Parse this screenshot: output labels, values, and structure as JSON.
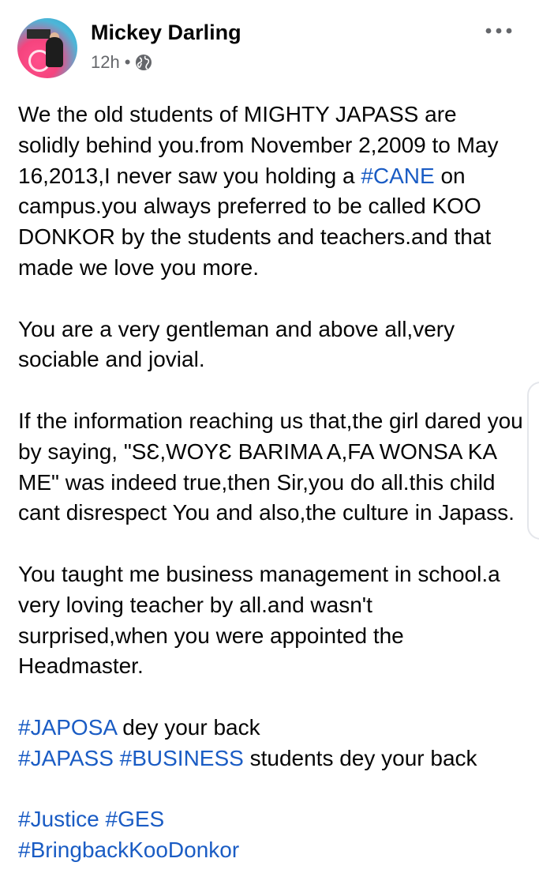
{
  "post": {
    "author": "Mickey Darling",
    "time": "12h",
    "separator": "•",
    "privacy_icon": "globe-icon",
    "more_icon": "more-options-icon",
    "paragraphs": [
      {
        "segments": [
          {
            "text": "We the old students of MIGHTY JAPASS are solidly behind you.from November 2,2009 to May 16,2013,I never saw you holding a "
          },
          {
            "text": "#CANE",
            "hashtag": true
          },
          {
            "text": " on campus.you always preferred to be called KOO DONKOR by the students and teachers.and that made we love you more."
          }
        ]
      },
      {
        "segments": [
          {
            "text": "You are a very gentleman and above all,very sociable and jovial."
          }
        ]
      },
      {
        "segments": [
          {
            "text": "If the information reaching us that,the girl dared you by saying, \"SƐ,WOYƐ BARIMA A,FA WONSA KA ME\" was indeed true,then Sir,you do all.this child cant disrespect You and also,the culture in Japass."
          }
        ]
      },
      {
        "segments": [
          {
            "text": "You taught me business management in school.a very loving teacher by all.and wasn't surprised,when you were appointed the Headmaster."
          }
        ]
      },
      {
        "segments": [
          {
            "text": "#JAPOSA",
            "hashtag": true
          },
          {
            "text": " dey your back"
          }
        ]
      },
      {
        "segments": [
          {
            "text": "#JAPASS",
            "hashtag": true
          },
          {
            "text": " "
          },
          {
            "text": "#BUSINESS",
            "hashtag": true
          },
          {
            "text": " students dey your back"
          }
        ]
      },
      {
        "segments": [
          {
            "text": "#Justice",
            "hashtag": true
          },
          {
            "text": " "
          },
          {
            "text": "#GES",
            "hashtag": true
          }
        ]
      },
      {
        "segments": [
          {
            "text": "#BringbackKooDonkor",
            "hashtag": true
          }
        ]
      }
    ]
  },
  "colors": {
    "text": "#050505",
    "meta": "#65676b",
    "hashtag": "#1a5cc4"
  }
}
